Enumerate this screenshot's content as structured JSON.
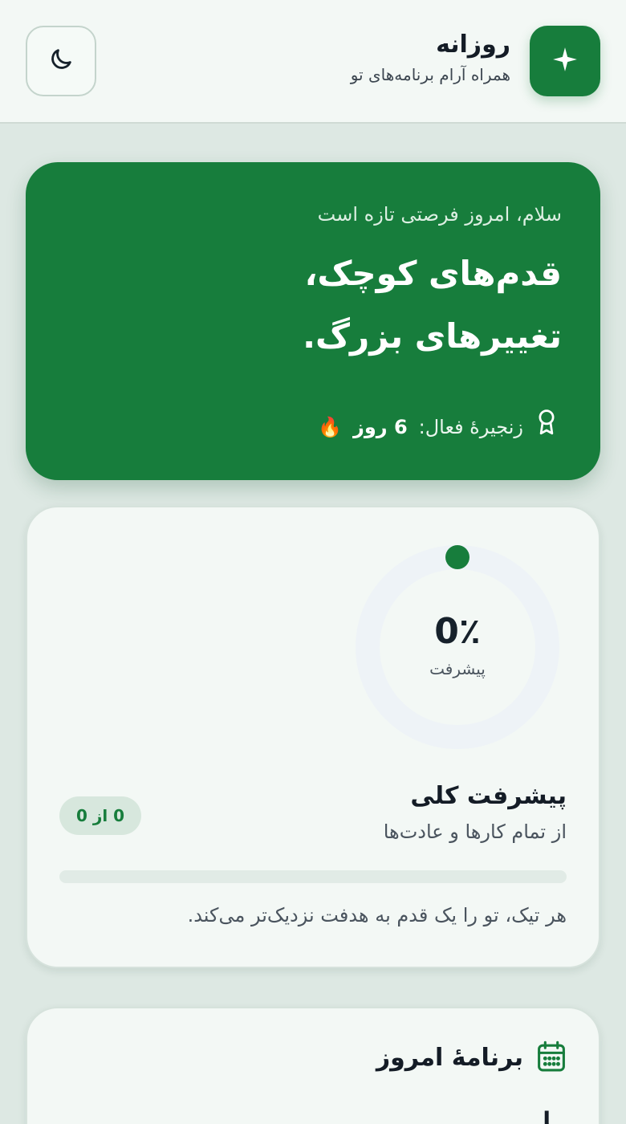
{
  "header": {
    "title": "روزانه",
    "subtitle": "همراه آرام برنامه‌های تو",
    "logo_icon": "sparkle-icon",
    "theme_icon": "moon-icon"
  },
  "hero": {
    "greeting": "سلام، امروز فرصتی تازه است",
    "headline_line1": "قدم‌های کوچک،",
    "headline_line2": "تغییرهای بزرگ.",
    "streak_label": "زنجیرهٔ فعال:",
    "streak_value": "6 روز",
    "streak_emoji": "🔥",
    "streak_icon": "award-icon"
  },
  "progress": {
    "percent_text": "0٪",
    "percent_value": 0,
    "ring_label": "پیشرفت",
    "title": "پیشرفت کلی",
    "subtitle": "از تمام کارها و عادت‌ها",
    "count_badge": "0 از 0",
    "tip": "هر تیک، تو را یک قدم به هدفت نزدیک‌تر می‌کند."
  },
  "today": {
    "title": "برنامهٔ امروز",
    "icon": "calendar-icon",
    "peek_text": "ــا"
  },
  "colors": {
    "accent": "#177d3c",
    "background": "#dde8e3",
    "card": "#f3f8f5",
    "ring_track": "#eef3f7"
  }
}
